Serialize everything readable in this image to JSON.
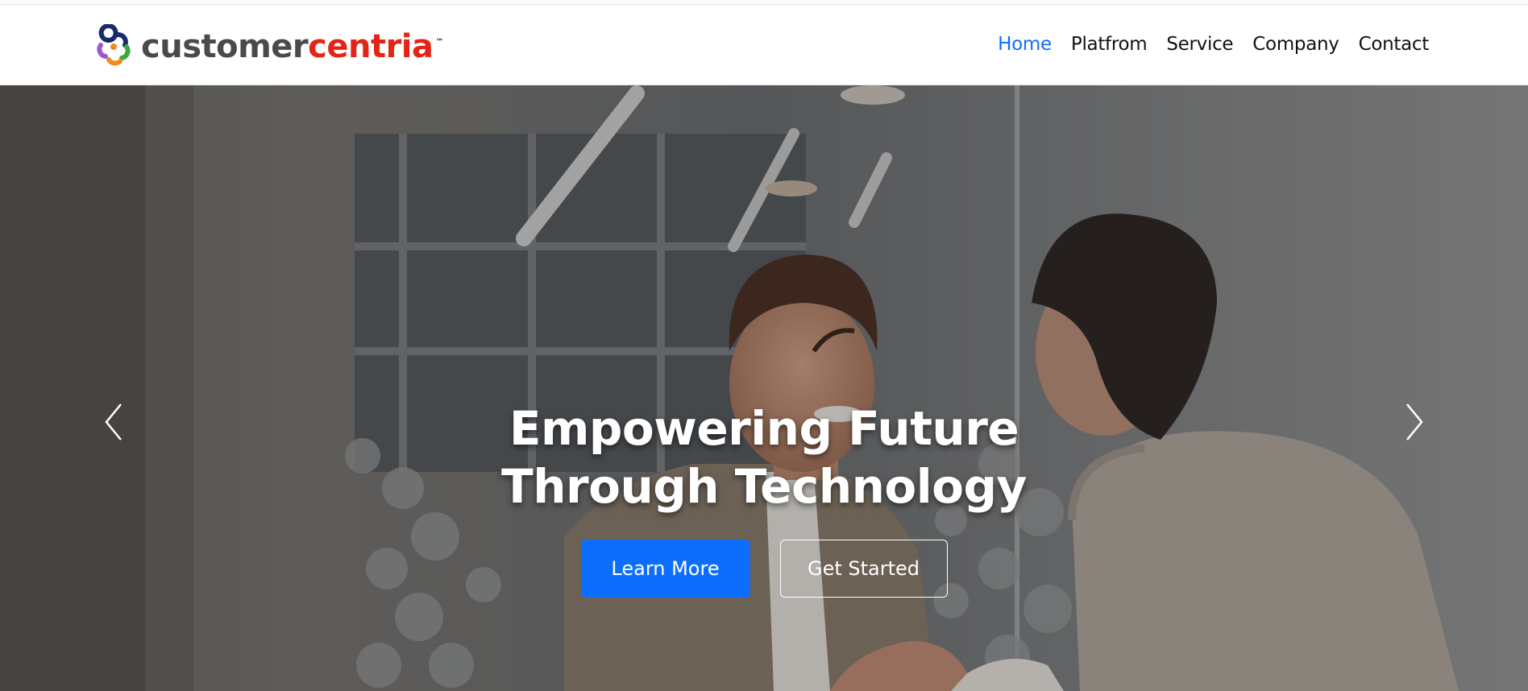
{
  "brand": {
    "name_part1": "customer",
    "name_part2": "centria",
    "trademark": "™",
    "colors": {
      "text_dark": "#4a4a4a",
      "text_accent": "#e42416"
    }
  },
  "nav": {
    "items": [
      {
        "label": "Home",
        "active": true
      },
      {
        "label": "Platfrom",
        "active": false
      },
      {
        "label": "Service",
        "active": false
      },
      {
        "label": "Company",
        "active": false
      },
      {
        "label": "Contact",
        "active": false
      }
    ],
    "active_color": "#0d6efd"
  },
  "hero": {
    "headline": "Empowering Future Through Technology",
    "primary_button": "Learn More",
    "secondary_button": "Get Started",
    "prev_icon": "chevron-left-icon",
    "next_icon": "chevron-right-icon",
    "image_description_icon": "handshake-photo",
    "colors": {
      "primary": "#0d6efd",
      "text": "#ffffff"
    }
  }
}
